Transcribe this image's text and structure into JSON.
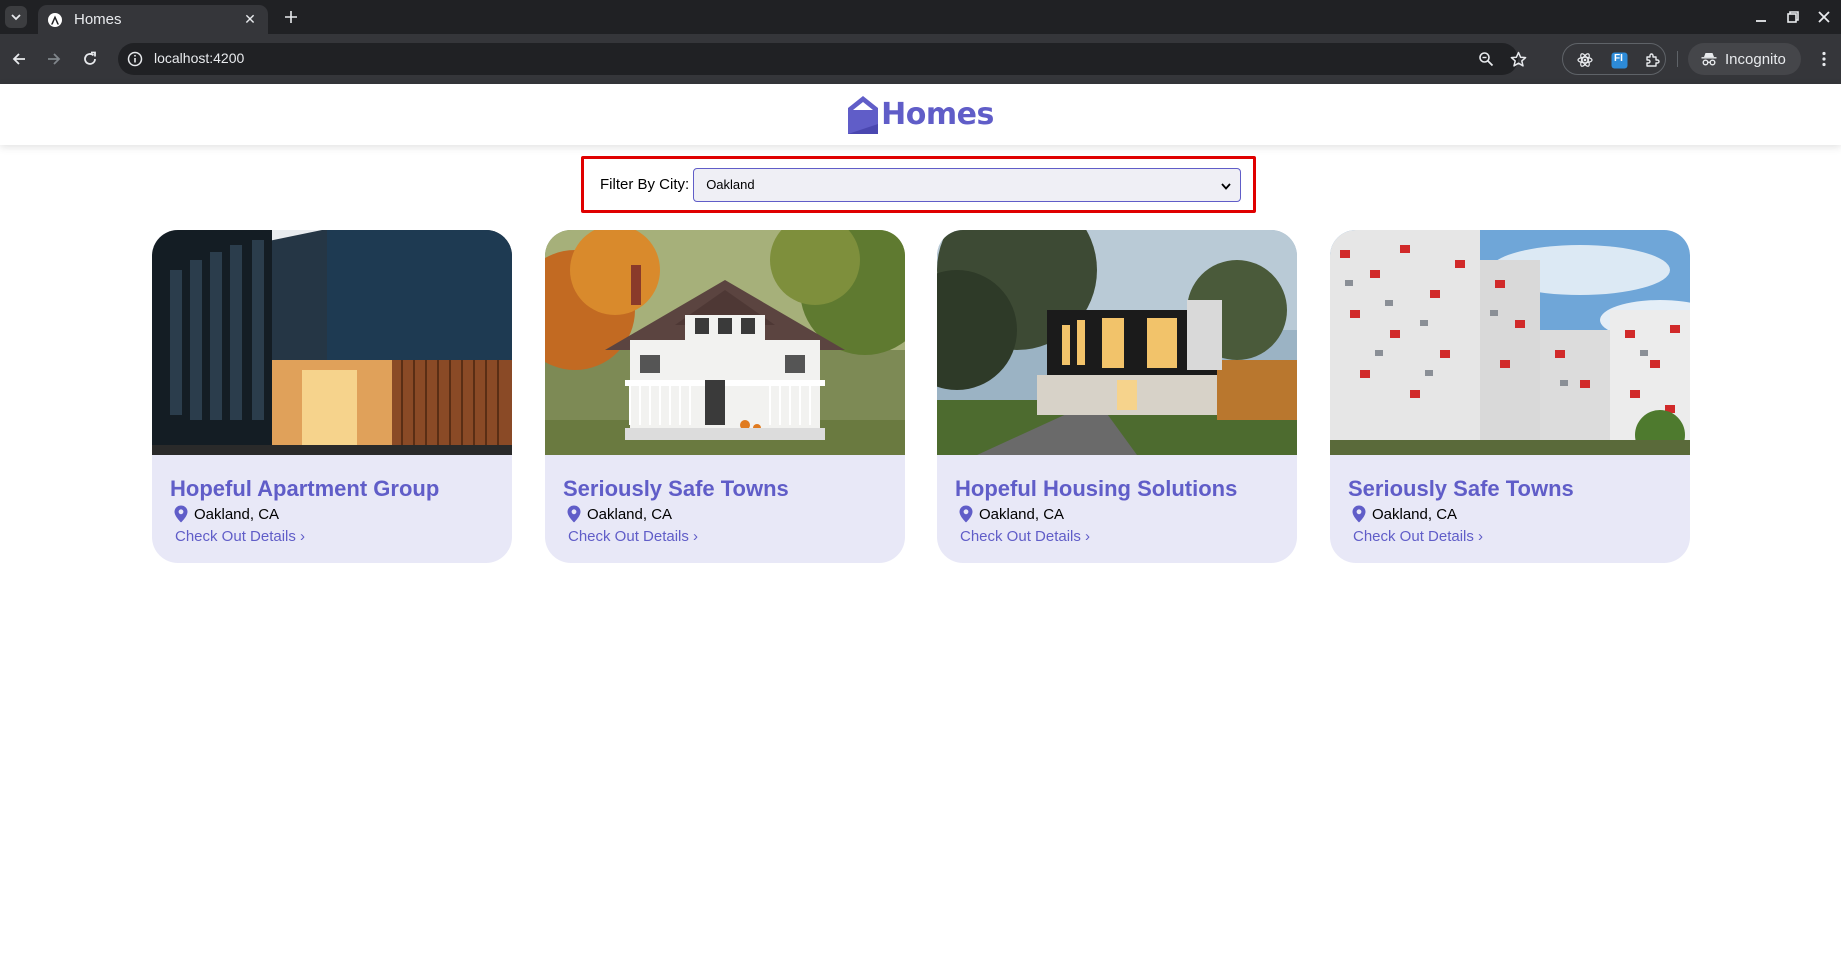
{
  "browser": {
    "tab_title": "Homes",
    "url": "localhost:4200",
    "profile_label": "Incognito",
    "extension_badge": "FI"
  },
  "app": {
    "brand": "Homes",
    "brand_color": "#605dc8",
    "filter": {
      "label": "Filter By City:",
      "selected": "Oakland"
    }
  },
  "listings": [
    {
      "name": "Hopeful Apartment Group",
      "location": "Oakland, CA",
      "link": "Check Out Details ›",
      "photo": "modern-dark-apartment"
    },
    {
      "name": "Seriously Safe Towns",
      "location": "Oakland, CA",
      "link": "Check Out Details ›",
      "photo": "white-house-autumn"
    },
    {
      "name": "Hopeful Housing Solutions",
      "location": "Oakland, CA",
      "link": "Check Out Details ›",
      "photo": "modern-black-house-garden"
    },
    {
      "name": "Seriously Safe Towns",
      "location": "Oakland, CA",
      "link": "Check Out Details ›",
      "photo": "white-red-highrise"
    }
  ]
}
